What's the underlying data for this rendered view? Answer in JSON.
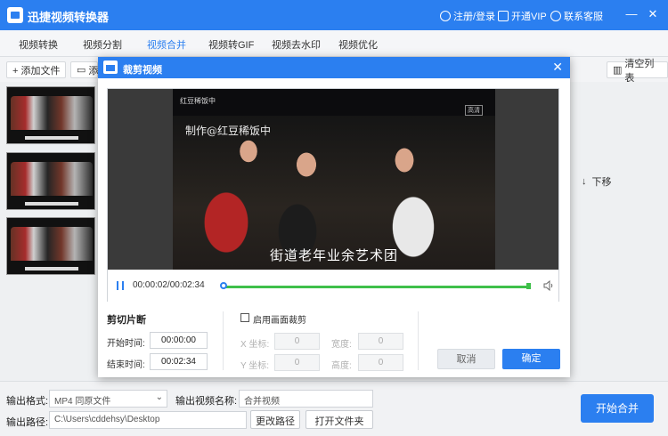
{
  "app": {
    "title": "迅捷视频转换器"
  },
  "header": {
    "login": "注册/登录",
    "vip": "开通VIP",
    "support": "联系客服"
  },
  "tabs": [
    "视频转换",
    "视频分割",
    "视频合并",
    "视频转GIF",
    "视频去水印",
    "视频优化"
  ],
  "active_tab_index": 2,
  "toolbar": {
    "add_file": "+ 添加文件",
    "add_folder": "添",
    "clear_list": "清空列表"
  },
  "list": {
    "move_down": "下移"
  },
  "dialog": {
    "title": "裁剪视频",
    "video": {
      "watermark_top": "红豆稀饭中",
      "credit": "制作@红豆稀饭中",
      "hd_badge": "高清",
      "subtitle": "街道老年业余艺术团"
    },
    "player": {
      "time": "00:00:02/00:02:34"
    },
    "clip": {
      "title": "剪切片断",
      "start_label": "开始时间:",
      "start_value": "00:00:00",
      "end_label": "结束时间:",
      "end_value": "00:02:34"
    },
    "crop": {
      "checkbox_label": "启用画面裁剪",
      "x_label": "X 坐标:",
      "y_label": "Y 坐标:",
      "width_label": "宽度:",
      "height_label": "高度:",
      "x_value": "0",
      "y_value": "0",
      "width_value": "0",
      "height_value": "0"
    },
    "cancel": "取消",
    "confirm": "确定"
  },
  "bottom": {
    "format_label": "输出格式:",
    "format_value": "MP4  同原文件",
    "name_label": "输出视频名称:",
    "name_value": "合并视频",
    "path_label": "输出路径:",
    "path_value": "C:\\Users\\cddehsy\\Desktop",
    "change_path": "更改路径",
    "open_folder": "打开文件夹",
    "start_merge": "开始合并"
  },
  "colors": {
    "accent": "#2b7ff0",
    "progress": "#3fc04a"
  }
}
